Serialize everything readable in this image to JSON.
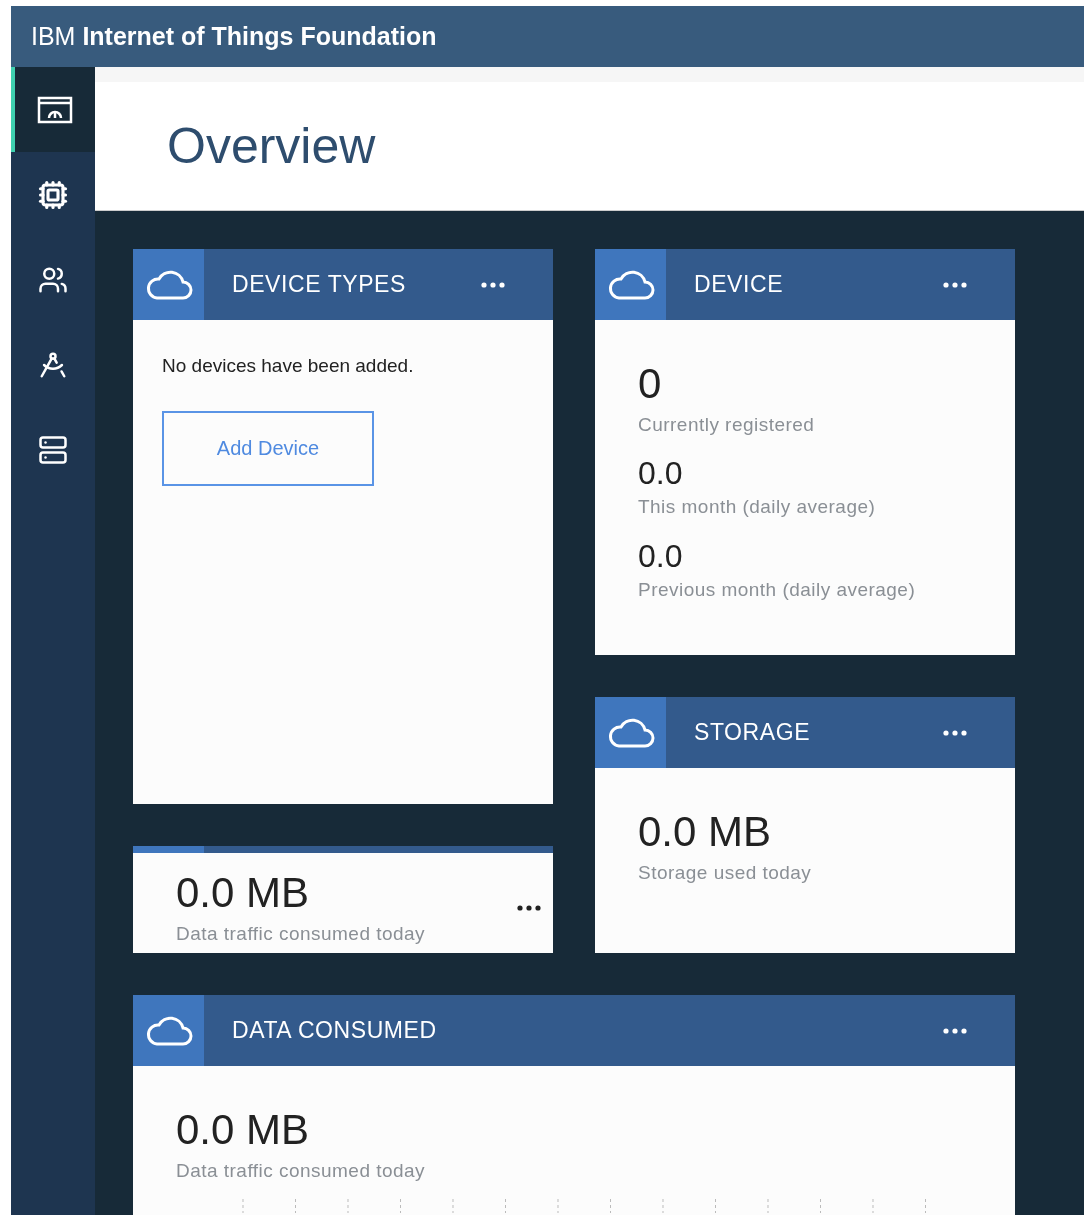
{
  "header": {
    "title": "IBM **Internet of Things Foundation**"
  },
  "sidebar": {
    "items": [
      {
        "selected": true
      },
      {
        "selected": false
      },
      {
        "selected": false
      },
      {
        "selected": false
      },
      {
        "selected": false
      }
    ]
  },
  "page": {
    "title": "Overview"
  },
  "cards": {
    "device_types": {
      "title": "DEVICE TYPES",
      "message": "No devices have been added.",
      "button": "Add Device"
    },
    "data_traffic": {
      "value": "0.0 MB",
      "caption": "Data traffic consumed today"
    },
    "device": {
      "title": "DEVICE",
      "stats": [
        {
          "value": "0",
          "caption": "Currently registered"
        },
        {
          "value": "0.0",
          "caption": "This month (daily average)"
        },
        {
          "value": "0.0",
          "caption": "Previous month (daily average)"
        }
      ]
    },
    "storage": {
      "title": "STORAGE",
      "value": "0.0 MB",
      "caption": "Storage used today"
    },
    "data_consumed": {
      "title": "DATA CONSUMED",
      "value": "0.0 MB",
      "caption": "Data traffic consumed today"
    }
  }
}
